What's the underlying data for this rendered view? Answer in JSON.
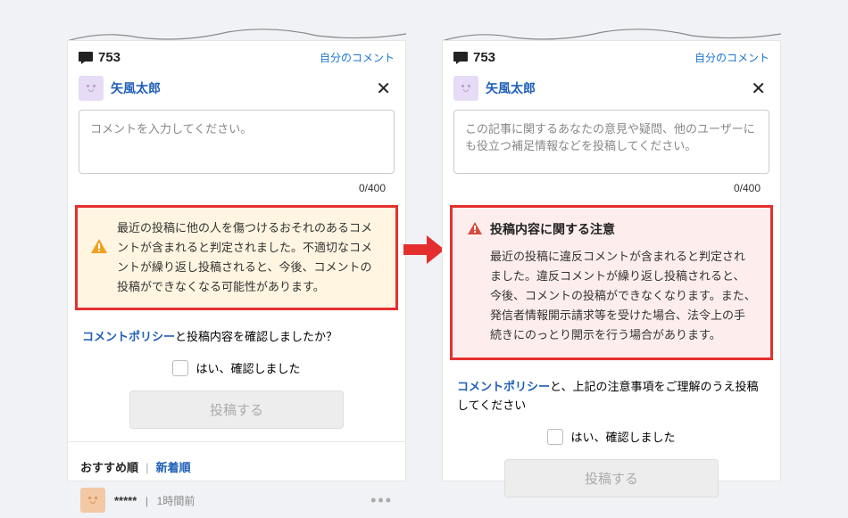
{
  "left": {
    "comment_count": "753",
    "my_comment_link": "自分のコメント",
    "username": "矢風太郎",
    "textarea_placeholder": "コメントを入力してください。",
    "char_count": "0/400",
    "warning": "最近の投稿に他の人を傷つけるおそれのあるコメントが含まれると判定されました。不適切なコメントが繰り返し投稿されると、今後、コメントの投稿ができなくなる可能性があります。",
    "policy_link": "コメントポリシー",
    "policy_suffix": "と投稿内容を確認しましたか？",
    "confirm_label": "はい、確認しました",
    "submit_label": "投稿する",
    "sort_recommended": "おすすめ順",
    "sort_newest": "新着順",
    "comment_user": "*****",
    "comment_time": "1時間前"
  },
  "right": {
    "comment_count": "753",
    "my_comment_link": "自分のコメント",
    "username": "矢風太郎",
    "textarea_placeholder": "この記事に関するあなたの意見や疑問、他のユーザーにも役立つ補足情報などを投稿してください。",
    "char_count": "0/400",
    "warning_title": "投稿内容に関する注意",
    "warning_body": "最近の投稿に違反コメントが含まれると判定されました。違反コメントが繰り返し投稿されると、今後、コメントの投稿ができなくなります。また、発信者情報開示請求等を受けた場合、法令上の手続きにのっとり開示を行う場合があります。",
    "policy_link": "コメントポリシー",
    "policy_suffix": "と、上記の注意事項をご理解のうえ投稿してください",
    "confirm_label": "はい、確認しました",
    "submit_label": "投稿する"
  }
}
